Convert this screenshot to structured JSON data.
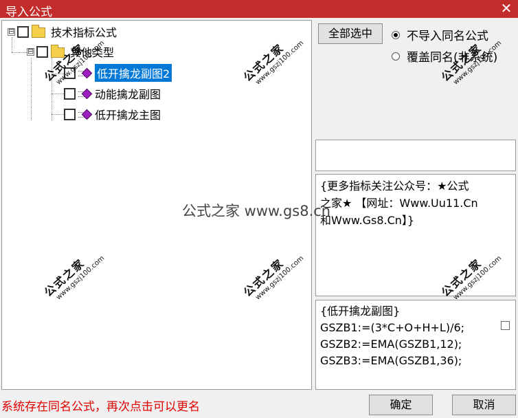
{
  "window": {
    "title": "导入公式",
    "close_glyph": "✕"
  },
  "tree": {
    "root": {
      "expander": "⊟",
      "label": "技术指标公式"
    },
    "group": {
      "expander": "⊟",
      "label": "其他类型"
    },
    "items": [
      {
        "label": "低开擒龙副图2",
        "selected": true
      },
      {
        "label": "动能擒龙副图",
        "selected": false
      },
      {
        "label": "低开擒龙主图",
        "selected": false
      }
    ]
  },
  "buttons": {
    "select_all": "全部选中",
    "ok": "确定",
    "cancel": "取消"
  },
  "options": {
    "no_import_same": "不导入同名公式",
    "overwrite_same": "覆盖同名(非系统)",
    "selected": "no_import_same"
  },
  "description": {
    "line1": "{更多指标关注公众号：★公式",
    "line2": "之家★ 【网址：Www.Uu11.Cn",
    "line3": "和Www.Gs8.Cn】}"
  },
  "code": {
    "lines": [
      "{低开擒龙副图}",
      "GSZB1:=(3*C+O+H+L)/6;",
      "GSZB2:=EMA(GSZB1,12);",
      "GSZB3:=EMA(GSZB1,36);"
    ]
  },
  "watermark": {
    "stamp": "公式之家",
    "url": "www.gszj100.com",
    "center": "公式之家 www.gs8.cn"
  },
  "status": "系统存在同名公式，再次点击可以更名",
  "colors": {
    "titlebar": "#c42b2b",
    "selection": "#0078d7",
    "status": "#e00000",
    "icon_gem": "#9d1fbf",
    "folder": "#f4cf4a"
  },
  "icons": [
    "close-icon",
    "folder-icon",
    "formula-icon",
    "expander-icon"
  ]
}
